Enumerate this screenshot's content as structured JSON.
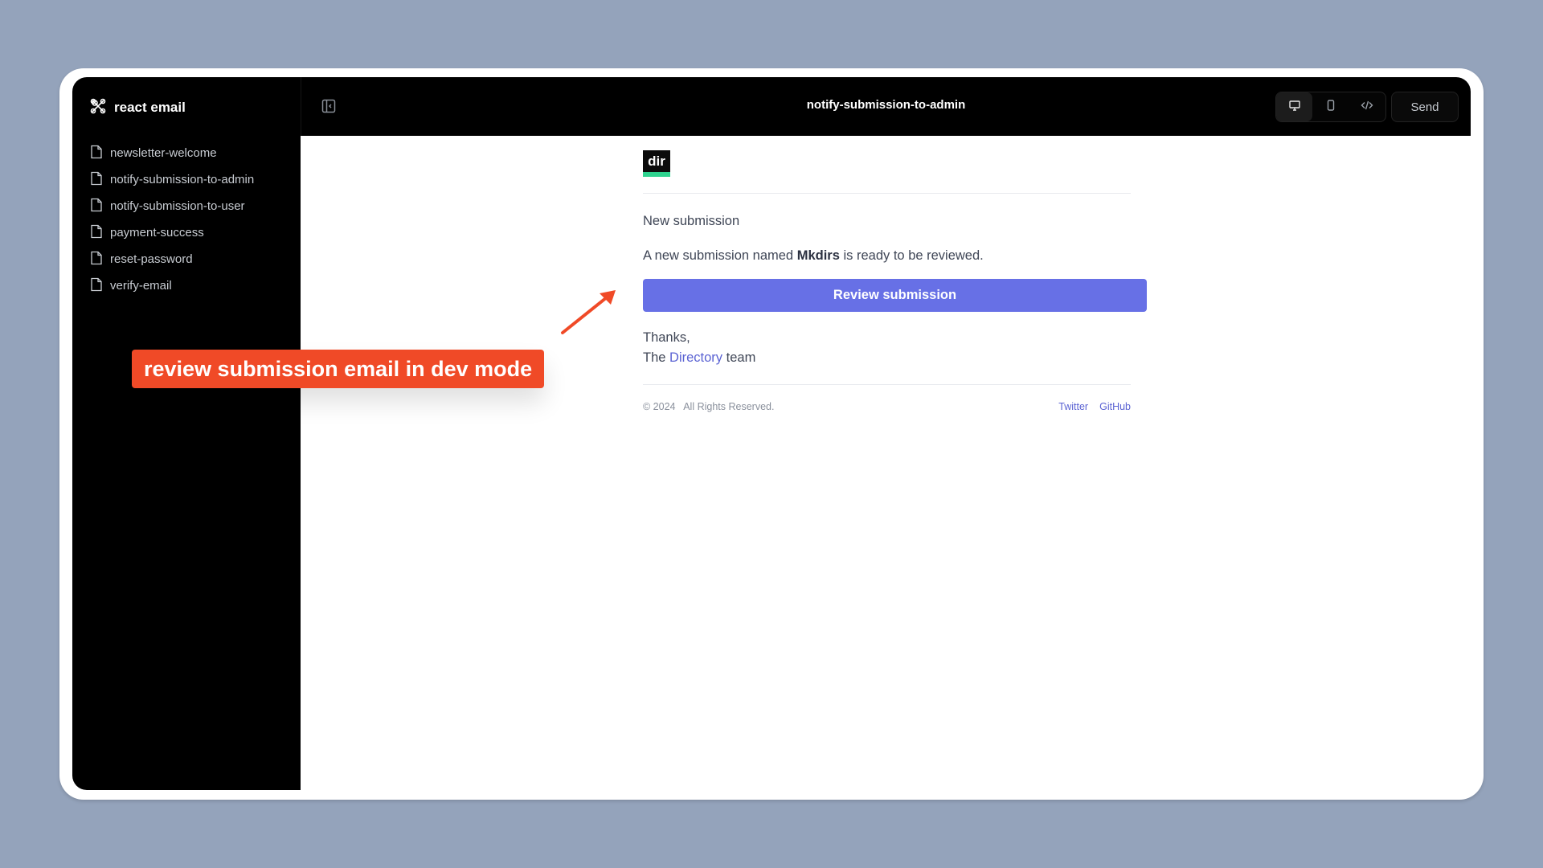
{
  "app": {
    "name": "react email"
  },
  "sidebar": {
    "items": [
      {
        "label": "newsletter-welcome"
      },
      {
        "label": "notify-submission-to-admin"
      },
      {
        "label": "notify-submission-to-user"
      },
      {
        "label": "payment-success"
      },
      {
        "label": "reset-password"
      },
      {
        "label": "verify-email"
      }
    ]
  },
  "topbar": {
    "title": "notify-submission-to-admin",
    "send_label": "Send",
    "view_modes": [
      "desktop-icon",
      "mobile-icon",
      "code-icon"
    ],
    "active_view": "desktop-icon"
  },
  "email": {
    "logo_text": "dir",
    "heading": "New submission",
    "body_prefix": "A new submission named",
    "submission_name": "Mkdirs",
    "body_suffix": "is ready to be reviewed.",
    "cta_label": "Review submission",
    "thanks": "Thanks,",
    "signoff_prefix": "The",
    "signoff_link": "Directory",
    "signoff_suffix": "team",
    "footer_copyright": "© 2024   All Rights Reserved.",
    "footer_links": [
      "Twitter",
      "GitHub"
    ],
    "accent_color": "#6770e6"
  },
  "annotation": {
    "text": "review submission email in dev mode",
    "color": "#f04a27"
  }
}
